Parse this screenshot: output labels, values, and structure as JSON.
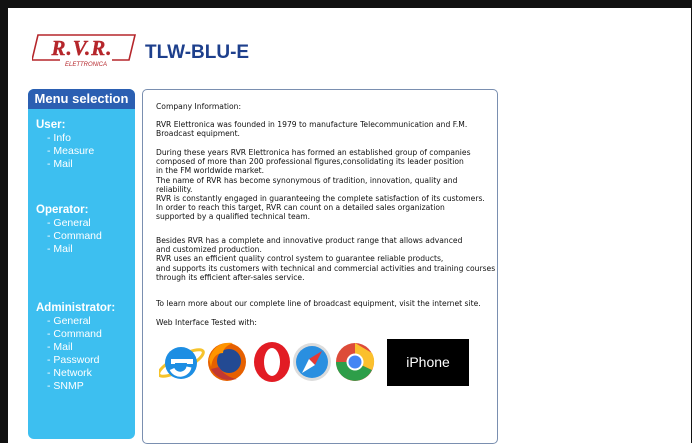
{
  "header": {
    "logo_text": "R.V.R.",
    "logo_subtext": "ELETTRONICA",
    "device_title": "TLW-BLU-E"
  },
  "sidebar": {
    "title": "Menu selection",
    "sections": [
      {
        "title": "User:",
        "items": [
          "- Info",
          "- Measure",
          "- Mail"
        ]
      },
      {
        "title": "Operator:",
        "items": [
          "- General",
          "- Command",
          "- Mail"
        ]
      },
      {
        "title": "Administrator:",
        "items": [
          "- General",
          "- Command",
          "- Mail",
          "- Password",
          "- Network",
          "- SNMP"
        ]
      }
    ]
  },
  "content": {
    "heading": "Company Information:",
    "p1": "RVR Elettronica was founded in 1979 to manufacture Telecommunication and F.M.\nBroadcast equipment.",
    "p2": "During these years RVR Elettronica has formed an established group of companies\ncomposed of more than 200 professional figures,consolidating its leader position\nin the FM worldwide market.\nThe name of RVR has become synonymous of tradition, innovation, quality and\nreliability.\nRVR is constantly engaged in guaranteeing the complete satisfaction of its customers.\nIn order to reach this target, RVR can count on a detailed sales organization\nsupported by a qualified technical team.",
    "p3": "Besides RVR has a complete and innovative product range that allows advanced\nand customized production.\nRVR uses an efficient quality control system to guarantee reliable products,\nand supports its customers with technical and commercial activities and training courses\nthrough its efficient after-sales service.",
    "p4": "To learn more about our complete line of broadcast equipment, visit the internet site.",
    "tested_label": "Web Interface Tested with:",
    "iphone_label": "iPhone",
    "apple_glyph": ""
  },
  "colors": {
    "sidebar_bg": "#3dbff0",
    "sidebar_header_bg": "#2b5fb2",
    "title_blue": "#1d3f8c",
    "logo_red": "#b5262b"
  },
  "icons": [
    "internet-explorer-icon",
    "firefox-icon",
    "opera-icon",
    "safari-icon",
    "chrome-icon",
    "apple-icon"
  ]
}
